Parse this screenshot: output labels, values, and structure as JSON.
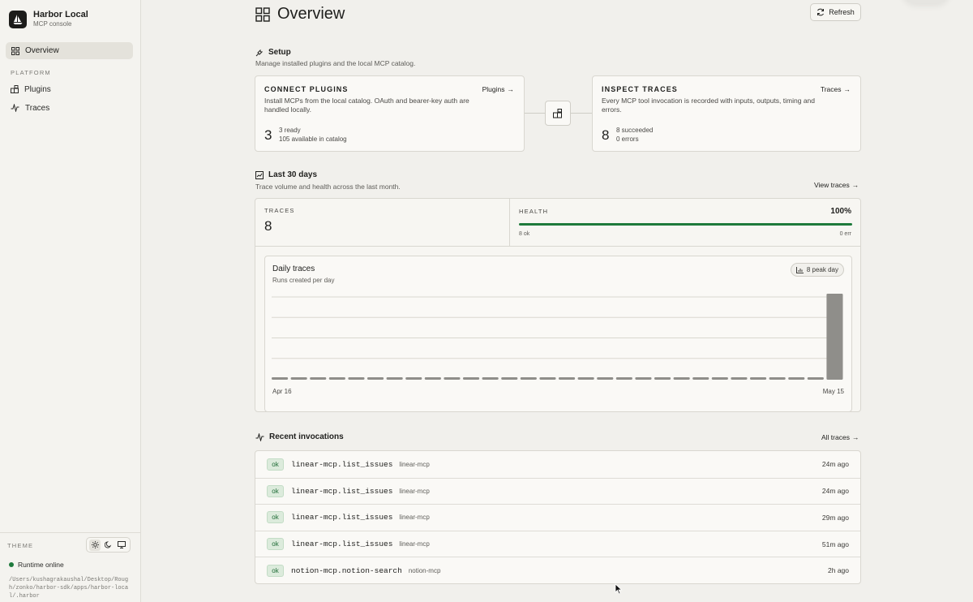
{
  "app": {
    "name": "Harbor Local",
    "subtitle": "MCP console"
  },
  "sidebar": {
    "active_item": "Overview",
    "section_label": "PLATFORM",
    "items": [
      {
        "label": "Plugins"
      },
      {
        "label": "Traces"
      }
    ],
    "theme_label": "THEME",
    "runtime_status": "Runtime online",
    "path": "/Users/kushagrakaushal/Desktop/Rough/zonko/harbor-sdk/apps/harbor-local/.harbor"
  },
  "header": {
    "title": "Overview",
    "refresh_label": "Refresh"
  },
  "setup": {
    "title": "Setup",
    "subtitle": "Manage installed plugins and the local MCP catalog.",
    "connect": {
      "title": "CONNECT PLUGINS",
      "link": "Plugins",
      "description": "Install MCPs from the local catalog. OAuth and bearer-key auth are handled locally.",
      "count": "3",
      "line1": "3 ready",
      "line2": "105 available in catalog"
    },
    "inspect": {
      "title": "INSPECT TRACES",
      "link": "Traces",
      "description": "Every MCP tool invocation is recorded with inputs, outputs, timing and errors.",
      "count": "8",
      "line1": "8 succeeded",
      "line2": "0 errors"
    }
  },
  "last30": {
    "title": "Last 30 days",
    "subtitle": "Trace volume and health across the last month.",
    "view_link": "View traces",
    "traces_label": "TRACES",
    "traces_value": "8",
    "health_label": "HEALTH",
    "health_value": "100%",
    "health_ok": "8 ok",
    "health_err": "0 err",
    "health_fraction": 1.0
  },
  "chart_data": {
    "type": "bar",
    "title": "Daily traces",
    "subtitle": "Runs created per day",
    "badge": "8 peak day",
    "x_start_label": "Apr 16",
    "x_end_label": "May 15",
    "values": [
      0,
      0,
      0,
      0,
      0,
      0,
      0,
      0,
      0,
      0,
      0,
      0,
      0,
      0,
      0,
      0,
      0,
      0,
      0,
      0,
      0,
      0,
      0,
      0,
      0,
      0,
      0,
      0,
      0,
      8
    ],
    "ylim": [
      0,
      8
    ],
    "grid": true
  },
  "recent": {
    "title": "Recent invocations",
    "all_link": "All traces",
    "rows": [
      {
        "status": "ok",
        "name": "linear-mcp.list_issues",
        "server": "linear-mcp",
        "time": "24m ago"
      },
      {
        "status": "ok",
        "name": "linear-mcp.list_issues",
        "server": "linear-mcp",
        "time": "24m ago"
      },
      {
        "status": "ok",
        "name": "linear-mcp.list_issues",
        "server": "linear-mcp",
        "time": "29m ago"
      },
      {
        "status": "ok",
        "name": "linear-mcp.list_issues",
        "server": "linear-mcp",
        "time": "51m ago"
      },
      {
        "status": "ok",
        "name": "notion-mcp.notion-search",
        "server": "notion-mcp",
        "time": "2h ago"
      }
    ]
  },
  "colors": {
    "accent_green": "#1e7a3c",
    "bar_gray": "#8f8e8a",
    "background": "#f1f0ec"
  },
  "icons": {
    "overview": "grid-icon",
    "plugins": "puzzle-icon",
    "traces": "activity-icon",
    "refresh": "refresh-icon",
    "setup": "plug-icon",
    "chart": "bar-chart-icon"
  }
}
